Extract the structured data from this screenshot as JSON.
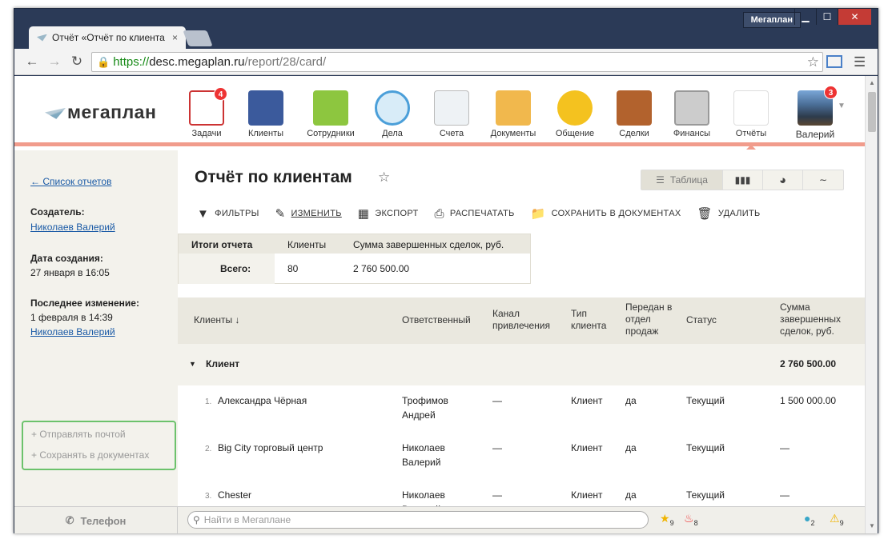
{
  "window": {
    "profile_label": "Мегаплан",
    "minimize": "▁",
    "maximize": "☐",
    "close": "✕"
  },
  "browser": {
    "tab_title": "Отчёт «Отчёт по клиента",
    "tab_close": "×",
    "url_scheme": "https://",
    "url_host": "desc.megaplan.ru",
    "url_path": "/report/28/card/"
  },
  "app": {
    "logo": "мегаплан",
    "modules": [
      {
        "label": "Задачи",
        "icon": "tasks-icon",
        "badge": "4"
      },
      {
        "label": "Клиенты",
        "icon": "clients-icon"
      },
      {
        "label": "Сотрудники",
        "icon": "employees-icon"
      },
      {
        "label": "Дела",
        "icon": "clock-icon"
      },
      {
        "label": "Счета",
        "icon": "invoices-icon"
      },
      {
        "label": "Документы",
        "icon": "folder-icon"
      },
      {
        "label": "Общение",
        "icon": "chat-icon"
      },
      {
        "label": "Сделки",
        "icon": "briefcase-icon"
      },
      {
        "label": "Финансы",
        "icon": "safe-icon"
      },
      {
        "label": "Отчёты",
        "icon": "reports-icon"
      }
    ],
    "user": {
      "name": "Валерий",
      "badge": "3"
    }
  },
  "sidebar": {
    "back_link": "← Список отчетов",
    "creator_label": "Создатель:",
    "creator": "Николаев Валерий",
    "created_label": "Дата создания:",
    "created": "27 января в 16:05",
    "modified_label": "Последнее изменение:",
    "modified": "1 февраля в 14:39",
    "modified_by": "Николаев Валерий",
    "send_mail": "+ Отправлять почтой",
    "save_docs": "+ Сохранять в документах"
  },
  "report": {
    "title": "Отчёт по клиентам",
    "view_table": "Таблица",
    "actions": {
      "filters": "ФИЛЬТРЫ",
      "edit": "ИЗМЕНИТЬ",
      "export": "ЭКСПОРТ",
      "print": "РАСПЕЧАТАТЬ",
      "save": "СОХРАНИТЬ В ДОКУМЕНТАХ",
      "delete": "УДАЛИТЬ"
    },
    "summary": {
      "h1": "Итоги отчета",
      "h2": "Клиенты",
      "h3": "Сумма завершенных сделок, руб.",
      "row_label": "Всего:",
      "clients": "80",
      "sum": "2 760 500.00"
    },
    "columns": {
      "client": "Клиенты ↓",
      "responsible": "Ответственный",
      "channel": "Канал привлечения",
      "type": "Тип клиента",
      "sent": "Передан в отдел продаж",
      "status": "Статус",
      "sum": "Сумма завершенных сделок, руб."
    },
    "group": {
      "label": "Клиент",
      "sum": "2 760 500.00"
    },
    "rows": [
      {
        "num": "1.",
        "client": "Александра Чёрная",
        "resp": "Трофимов Андрей",
        "channel": "—",
        "type": "Клиент",
        "sent": "да",
        "status": "Текущий",
        "sum": "1 500 000.00"
      },
      {
        "num": "2.",
        "client": "Big City торговый центр",
        "resp": "Николаев Валерий",
        "channel": "—",
        "type": "Клиент",
        "sent": "да",
        "status": "Текущий",
        "sum": "—"
      },
      {
        "num": "3.",
        "client": "Chester",
        "resp": "Николаев Валерий",
        "channel": "—",
        "type": "Клиент",
        "sent": "да",
        "status": "Текущий",
        "sum": "—"
      }
    ]
  },
  "statusbar": {
    "phone": "Телефон",
    "search_placeholder": "Найти в Мегаплане",
    "favorites": "9",
    "hot": "8",
    "messages": "2",
    "alerts": "9"
  }
}
